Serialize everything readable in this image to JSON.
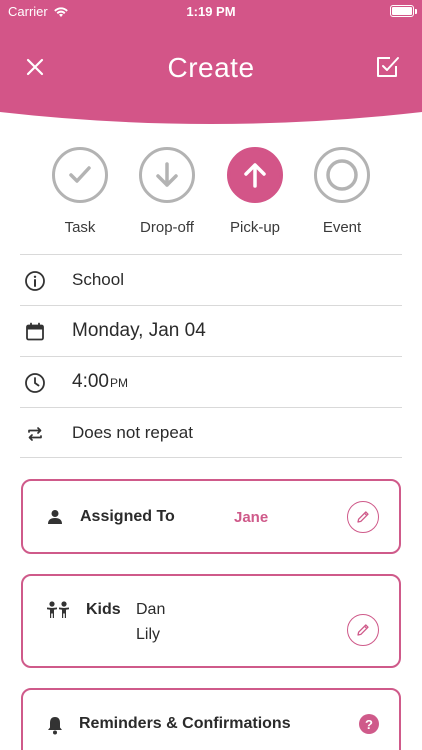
{
  "status_bar": {
    "carrier": "Carrier",
    "time": "1:19 PM"
  },
  "header": {
    "title": "Create",
    "close_icon": "close-icon",
    "save_icon": "check-square-icon",
    "color": "#d35588"
  },
  "types": [
    {
      "label": "Task",
      "icon": "checkmark-icon",
      "active": false
    },
    {
      "label": "Drop-off",
      "icon": "arrow-down-icon",
      "active": false
    },
    {
      "label": "Pick-up",
      "icon": "arrow-up-icon",
      "active": true
    },
    {
      "label": "Event",
      "icon": "ring-icon",
      "active": false
    }
  ],
  "details": {
    "name": "School",
    "date": "Monday, Jan 04",
    "time": "4:00",
    "time_suffix": "PM",
    "repeat": "Does not repeat"
  },
  "assigned": {
    "title": "Assigned To",
    "value": "Jane"
  },
  "kids": {
    "title": "Kids",
    "names": [
      "Dan",
      "Lily"
    ]
  },
  "reminders": {
    "title": "Reminders & Confirmations",
    "help": "?"
  },
  "colors": {
    "accent": "#cf5a8a",
    "inactive": "#b3b3b3"
  }
}
